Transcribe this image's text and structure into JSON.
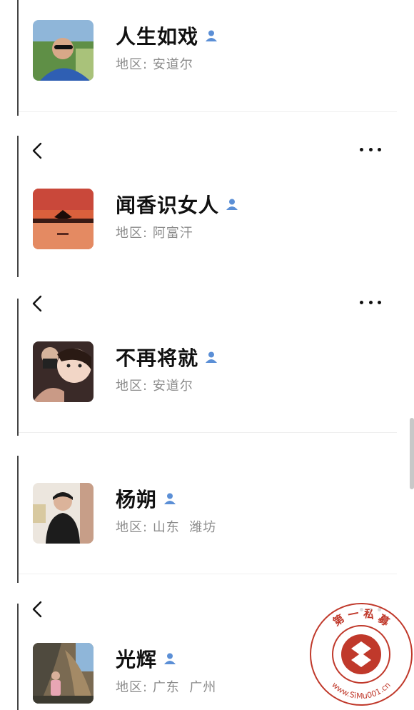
{
  "colors": {
    "accent": "#5b8fd6",
    "seal_red": "#c0392b"
  },
  "region_label": "地区:",
  "contacts": [
    {
      "name": "人生如戏",
      "region_label": "地区:",
      "region": "安道尔",
      "avatar": "man-sunglasses-photo"
    },
    {
      "name": "闻香识女人",
      "region_label": "地区:",
      "region": "阿富汗",
      "avatar": "sunset-rider-photo"
    },
    {
      "name": "不再将就",
      "region_label": "地区:",
      "region": "安道尔",
      "avatar": "girls-selfie-photo"
    },
    {
      "name": "杨朔",
      "region_label": "地区:",
      "region": "山东  潍坊",
      "avatar": "person-portrait-photo"
    },
    {
      "name": "光辉",
      "region_label": "地区:",
      "region": "广东  广州",
      "avatar": "cave-tourist-photo"
    }
  ],
  "watermark": {
    "text": "第 一 私 募",
    "url": "www.SiMu001.cn"
  }
}
